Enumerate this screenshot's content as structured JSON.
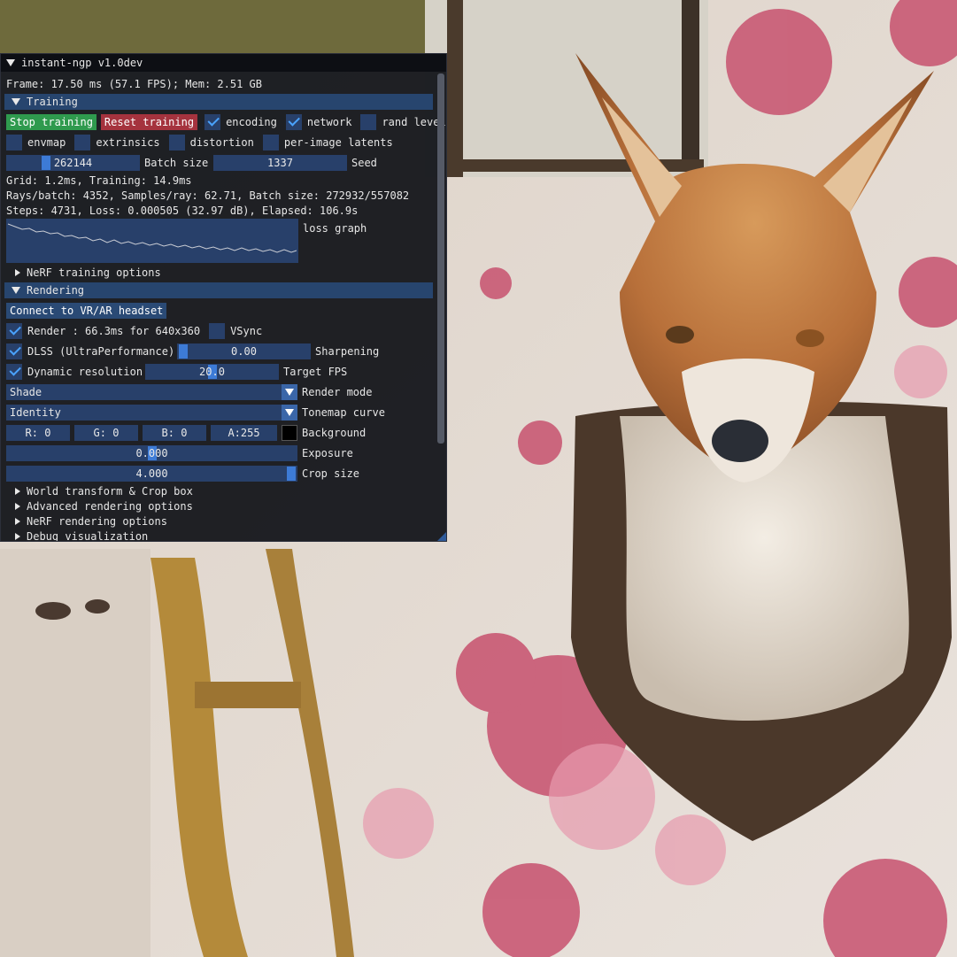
{
  "window": {
    "title": "instant-ngp v1.0dev",
    "frame_info": "Frame: 17.50 ms (57.1 FPS); Mem: 2.51 GB"
  },
  "training": {
    "header": "Training",
    "stop_label": "Stop training",
    "reset_label": "Reset training",
    "encoding_label": "encoding",
    "encoding_checked": true,
    "network_label": "network",
    "network_checked": true,
    "rand_level_label": "rand level",
    "rand_level_checked": false,
    "envmap_label": "envmap",
    "extrinsics_label": "extrinsics",
    "distortion_label": "distortion",
    "per_image_latents_label": "per-image latents",
    "batch_size_value": "262144",
    "batch_size_label": "Batch size",
    "batch_size_fraction": 0.28,
    "seed_value": "1337",
    "seed_label": "Seed",
    "grid_info": "Grid: 1.2ms, Training: 14.9ms",
    "rays_info": "Rays/batch: 4352, Samples/ray: 62.71, Batch size: 272932/557082",
    "steps_info": "Steps: 4731, Loss: 0.000505 (32.97 dB), Elapsed: 106.9s",
    "loss_graph_label": "loss graph",
    "nerf_options_label": "NeRF training options"
  },
  "rendering": {
    "header": "Rendering",
    "vr_button": "Connect to VR/AR headset",
    "render_label": "Render : 66.3ms for 640x360",
    "render_checked": true,
    "vsync_label": "VSync",
    "vsync_checked": false,
    "dlss_label": "DLSS (UltraPerformance)",
    "dlss_checked": true,
    "sharpening_value": "0.00",
    "sharpening_label": "Sharpening",
    "sharpening_fraction": 0.0,
    "dynres_label": "Dynamic resolution",
    "dynres_checked": true,
    "target_fps_value": "20.0",
    "target_fps_label": "Target FPS",
    "target_fps_fraction": 0.5,
    "render_mode_value": "Shade",
    "render_mode_label": "Render mode",
    "tonemap_value": "Identity",
    "tonemap_label": "Tonemap curve",
    "bg_r": "R:  0",
    "bg_g": "G:  0",
    "bg_b": "B:  0",
    "bg_a": "A:255",
    "background_label": "Background",
    "background_color": "#000000",
    "exposure_value": "0.000",
    "exposure_label": "Exposure",
    "exposure_fraction": 0.5,
    "crop_value": "4.000",
    "crop_label": "Crop size",
    "crop_fraction": 1.0,
    "tree_items": [
      "World transform & Crop box",
      "Advanced rendering options",
      "NeRF rendering options",
      "Debug visualization"
    ]
  },
  "colors": {
    "accent": "#3d7bd6",
    "header_bg": "#27456e",
    "stop_button": "#2f9a4e",
    "reset_button": "#a5333e"
  }
}
